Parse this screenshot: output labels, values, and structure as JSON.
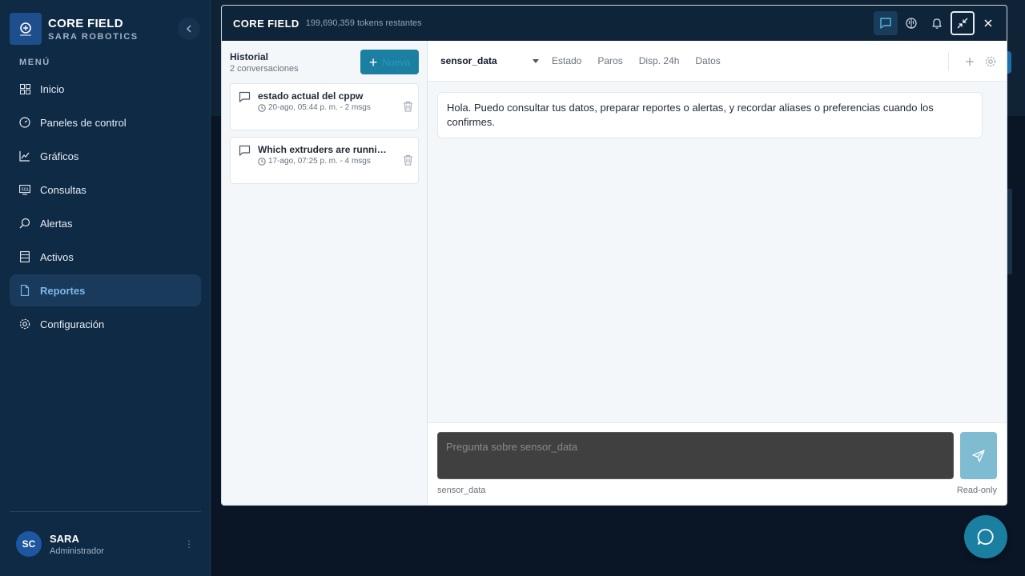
{
  "app": {
    "brand_title": "CORE FIELD",
    "brand_subtitle": "SARA ROBOTICS",
    "menu_label": "MENÚ"
  },
  "sidebar": {
    "items": [
      {
        "label": "Inicio",
        "icon": "grid-icon"
      },
      {
        "label": "Paneles de control",
        "icon": "gauge-icon"
      },
      {
        "label": "Gráficos",
        "icon": "line-chart-icon"
      },
      {
        "label": "Consultas",
        "icon": "sql-icon"
      },
      {
        "label": "Alertas",
        "icon": "search-alert-icon"
      },
      {
        "label": "Activos",
        "icon": "ledger-icon"
      },
      {
        "label": "Reportes",
        "icon": "file-icon",
        "active": true
      },
      {
        "label": "Configuración",
        "icon": "gear-icon"
      }
    ]
  },
  "user": {
    "initials": "SC",
    "name": "SARA",
    "role": "Administrador"
  },
  "modal": {
    "title": "CORE FIELD",
    "tokens": "199,690,359 tokens restantes"
  },
  "history": {
    "title": "Historial",
    "count": "2 conversaciones",
    "new_label": "Nueva",
    "conversations": [
      {
        "title": "estado actual del cppw",
        "meta": "20-ago, 05:44 p. m. - 2 msgs"
      },
      {
        "title": "Which extruders are running right now?",
        "meta": "17-ago, 07:25 p. m. - 4 msgs"
      }
    ]
  },
  "chat": {
    "source": "sensor_data",
    "tabs": [
      "Estado",
      "Paros",
      "Disp. 24h",
      "Datos"
    ],
    "message": "Hola. Puedo consultar tus datos, preparar reportes o alertas, y recordar aliases o preferencias cuando los confirmes.",
    "input_placeholder": "Pregunta sobre sensor_data",
    "footer_left": "sensor_data",
    "footer_right": "Read-only"
  },
  "colors": {
    "sidebar_bg": "#0f2a44",
    "accent": "#1b7fa1",
    "active_nav": "#1a3a5c"
  }
}
